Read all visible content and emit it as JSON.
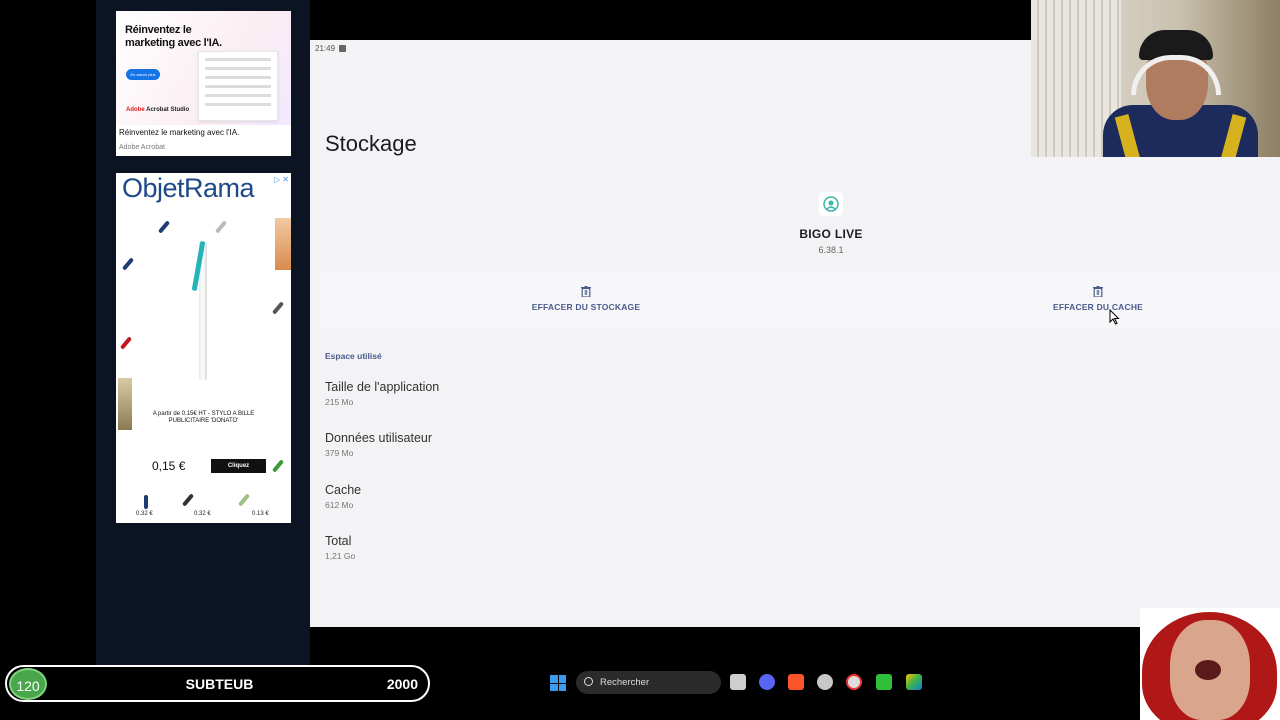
{
  "ads": {
    "ad1": {
      "headline": "Réinventez le marketing avec l'IA.",
      "button": "En savoir plus",
      "brand_prefix": "Adobe",
      "brand_rest": " Acrobat Studio",
      "caption": "Réinventez le marketing avec l'IA.",
      "advertiser": "Adobe Acrobat"
    },
    "ad2": {
      "logo": "ObjetRama",
      "choices": "▷ ✕",
      "promo": "A partir de 0.15€ HT - STYLO A BILLE PUBLICITAIRE 'DONATO'",
      "price": "0,15 €",
      "cta": "Cliquez",
      "mini_prices": [
        "0.32 €",
        "0.32 €",
        "0.13 €"
      ]
    }
  },
  "phone": {
    "status_time": "21:49",
    "page_title": "Stockage",
    "app": {
      "icon": "bigo-live-app-icon",
      "name": "BIGO LIVE",
      "version": "6.38.1"
    },
    "actions": {
      "clear_storage": "EFFACER DU STOCKAGE",
      "clear_cache": "EFFACER DU CACHE"
    },
    "section_label": "Espace utilisé",
    "rows": [
      {
        "label": "Taille de l'application",
        "value": "215 Mo"
      },
      {
        "label": "Données utilisateur",
        "value": "379 Mo"
      },
      {
        "label": "Cache",
        "value": "612 Mo"
      },
      {
        "label": "Total",
        "value": "1,21 Go"
      }
    ],
    "accent_color": "#4a5b8c"
  },
  "overlay": {
    "counter_value": "120",
    "name": "SUBTEUB",
    "goal": "2000"
  },
  "taskbar": {
    "search_placeholder": "Rechercher",
    "apps": [
      "windows-start-icon",
      "file-explorer-icon",
      "discord-icon",
      "brave-icon",
      "steam-icon",
      "obs-icon",
      "app-green-icon",
      "bluestacks-icon"
    ]
  }
}
